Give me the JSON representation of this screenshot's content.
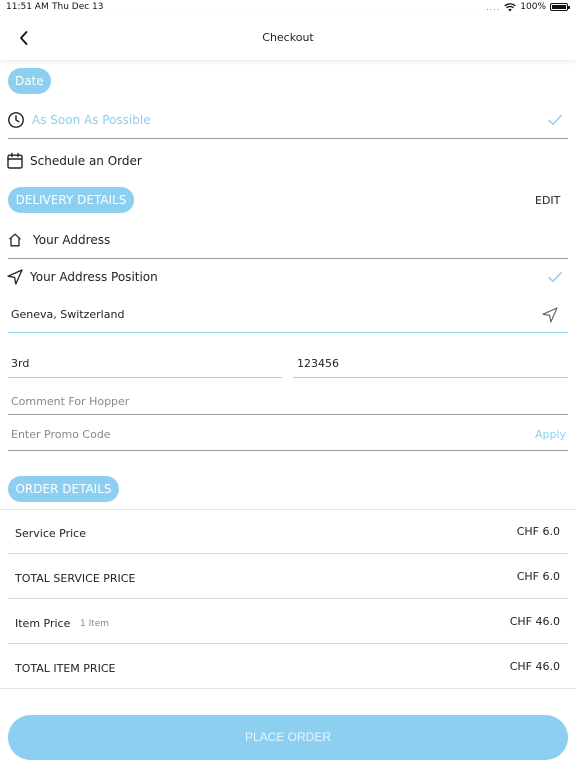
{
  "status_bar": {
    "time": "11:51 AM",
    "date": "Thu Dec 13",
    "dots": "....",
    "battery_percent": "100%",
    "battery_level": 1.0
  },
  "header": {
    "title": "Checkout",
    "back_icon": "chevron-left-icon"
  },
  "date_section": {
    "pill_label": "Date",
    "asap_label": "As Soon As Possible",
    "schedule_label": "Schedule an Order"
  },
  "delivery": {
    "pill_label": "DELIVERY DETAILS",
    "edit_label": "EDIT",
    "address_label": "Your Address",
    "position_label": "Your Address Position",
    "location_value": "Geneva, Switzerland",
    "floor_value": "3rd",
    "code_value": "123456",
    "comment_placeholder": "Comment For Hopper",
    "promo_placeholder": "Enter Promo Code",
    "apply_label": "Apply"
  },
  "order": {
    "pill_label": "ORDER DETAILS",
    "rows": [
      {
        "label": "Service Price",
        "sub": "",
        "value": "CHF  6.0"
      },
      {
        "label": "TOTAL SERVICE PRICE",
        "sub": "",
        "value": "CHF  6.0"
      },
      {
        "label": "Item Price",
        "sub": "1 Item",
        "value": "CHF  46.0"
      },
      {
        "label": "TOTAL ITEM PRICE",
        "sub": "",
        "value": "CHF  46.0"
      }
    ]
  },
  "place_order_label": "PLACE ORDER",
  "colors": {
    "accent": "#8ccff0",
    "accent_line": "#9fd4ef"
  }
}
